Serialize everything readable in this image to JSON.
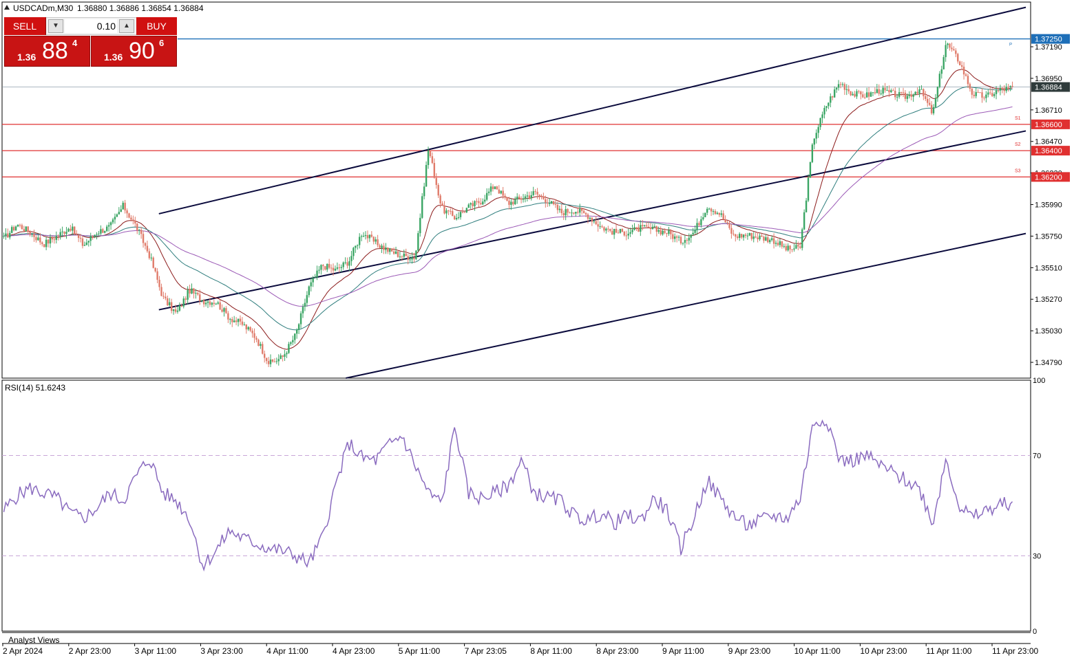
{
  "window": {
    "symbol_header": "USDCADm,M30",
    "ohlc": "1.36880 1.36886 1.36854 1.36884"
  },
  "trade_panel": {
    "sell_label": "SELL",
    "buy_label": "BUY",
    "lot": "0.10",
    "bid_prefix": "1.36",
    "bid_big": "88",
    "bid_sup": "4",
    "ask_prefix": "1.36",
    "ask_big": "90",
    "ask_sup": "6"
  },
  "colors": {
    "bull": "#3aa564",
    "bear": "#e07b6a",
    "sr_line": "#e03030",
    "channel": "#0a0a3c",
    "rsi": "#8a6bbf",
    "ma_fast": "#8b1a1a",
    "ma_mid": "#2e7d7d",
    "ma_slow": "#9b59b6",
    "price_tag_bg": "#2f3b3b",
    "peak_line": "#1e6fb8"
  },
  "chart_data": [
    {
      "type": "candlestick",
      "symbol": "USDCADm",
      "timeframe": "M30",
      "ylim": [
        1.3467,
        1.3753
      ],
      "price_ticks": [
        "1.37190",
        "1.36950",
        "1.36710",
        "1.36470",
        "1.36230",
        "1.35990",
        "1.35750",
        "1.35510",
        "1.35270",
        "1.35030",
        "1.34790"
      ],
      "time_ticks": [
        "2 Apr 2024",
        "2 Apr 23:00",
        "3 Apr 11:00",
        "3 Apr 23:00",
        "4 Apr 11:00",
        "4 Apr 23:00",
        "5 Apr 11:00",
        "7 Apr 23:05",
        "8 Apr 11:00",
        "8 Apr 23:00",
        "9 Apr 11:00",
        "9 Apr 23:00",
        "10 Apr 11:00",
        "10 Apr 23:00",
        "11 Apr 11:00",
        "11 Apr 23:00"
      ],
      "current_price": "1.36884",
      "peak_price": "1.37250",
      "peak_label": "P",
      "levels": [
        {
          "label": "S1",
          "value": "1.36600"
        },
        {
          "label": "S2",
          "value": "1.36400"
        },
        {
          "label": "S3",
          "value": "1.36200"
        }
      ],
      "close_path": [
        1.3573,
        1.3584,
        1.3578,
        1.3569,
        1.3575,
        1.3582,
        1.3568,
        1.3578,
        1.3582,
        1.3598,
        1.3582,
        1.356,
        1.3528,
        1.3516,
        1.3534,
        1.3526,
        1.3525,
        1.3513,
        1.3508,
        1.3498,
        1.3478,
        1.3483,
        1.35,
        1.3536,
        1.3553,
        1.3549,
        1.3556,
        1.3578,
        1.357,
        1.3564,
        1.356,
        1.3559,
        1.3642,
        1.3596,
        1.3589,
        1.3597,
        1.3602,
        1.3614,
        1.36,
        1.3604,
        1.3608,
        1.3602,
        1.3593,
        1.3595,
        1.3591,
        1.3582,
        1.3578,
        1.3578,
        1.3581,
        1.358,
        1.3578,
        1.3571,
        1.3578,
        1.3598,
        1.3592,
        1.3575,
        1.3576,
        1.3574,
        1.3572,
        1.3565,
        1.3566,
        1.3649,
        1.3675,
        1.3692,
        1.3683,
        1.3682,
        1.3686,
        1.3683,
        1.3681,
        1.3687,
        1.3668,
        1.3722,
        1.3708,
        1.3683,
        1.3681,
        1.3686,
        1.3688
      ],
      "channel_lines": [
        {
          "name": "upper",
          "p1": {
            "t": 0.152,
            "v": 1.3592
          },
          "p2": {
            "t": 0.996,
            "v": 1.3749
          }
        },
        {
          "name": "middle",
          "p1": {
            "t": 0.152,
            "v": 1.3519
          },
          "p2": {
            "t": 0.996,
            "v": 1.3655
          }
        },
        {
          "name": "lower",
          "p1": {
            "t": 0.334,
            "v": 1.3467
          },
          "p2": {
            "t": 0.996,
            "v": 1.3577
          }
        }
      ]
    },
    {
      "type": "line",
      "indicator": "RSI(14)",
      "label": "RSI(14) 51.6243",
      "value": 51.6243,
      "ylim": [
        0,
        100
      ],
      "levels": [
        30,
        70
      ],
      "y_ticks": [
        "100",
        "70",
        "30",
        "0"
      ],
      "values": [
        48,
        54,
        57,
        55,
        53,
        47,
        45,
        49,
        55,
        52,
        62,
        69,
        55,
        52,
        45,
        26,
        32,
        40,
        37,
        35,
        33,
        32,
        30,
        27,
        37,
        58,
        75,
        69,
        68,
        74,
        78,
        66,
        55,
        51,
        82,
        55,
        53,
        55,
        58,
        68,
        55,
        53,
        52,
        46,
        44,
        47,
        43,
        46,
        44,
        53,
        48,
        33,
        45,
        60,
        53,
        46,
        42,
        44,
        46,
        45,
        53,
        83,
        85,
        68,
        68,
        70,
        66,
        63,
        60,
        57,
        43,
        69,
        50,
        45,
        48,
        50,
        51.6
      ]
    }
  ],
  "footer": {
    "analyst_views": "Analyst Views"
  }
}
